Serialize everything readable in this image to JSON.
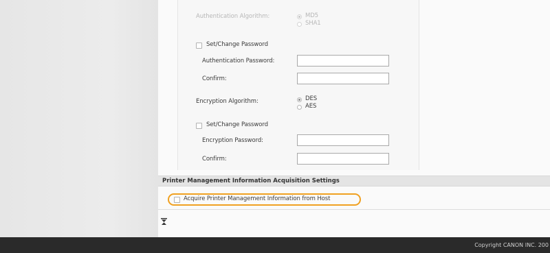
{
  "snmp": {
    "auth_algorithm": {
      "label": "Authentication Algorithm:",
      "options": [
        "MD5",
        "SHA1"
      ],
      "selected": "MD5"
    },
    "auth_password": {
      "set_change_label": "Set/Change Password",
      "password_label": "Authentication Password:",
      "password_value": "",
      "confirm_label": "Confirm:",
      "confirm_value": ""
    },
    "encryption_algorithm": {
      "label": "Encryption Algorithm:",
      "options": [
        "DES",
        "AES"
      ],
      "selected": "DES"
    },
    "encryption_password": {
      "set_change_label": "Set/Change Password",
      "password_label": "Encryption Password:",
      "password_value": "",
      "confirm_label": "Confirm:",
      "confirm_value": ""
    }
  },
  "printer_mgmt": {
    "section_title": "Printer Management Information Acquisition Settings",
    "acquire_label": "Acquire Printer Management Information from Host",
    "acquire_checked": false
  },
  "footer": {
    "copyright": "Copyright CANON INC. 200"
  },
  "colors": {
    "highlight": "#f0a020",
    "footer_bg": "#2a2a2a",
    "section_bar": "#e4e4e4"
  }
}
